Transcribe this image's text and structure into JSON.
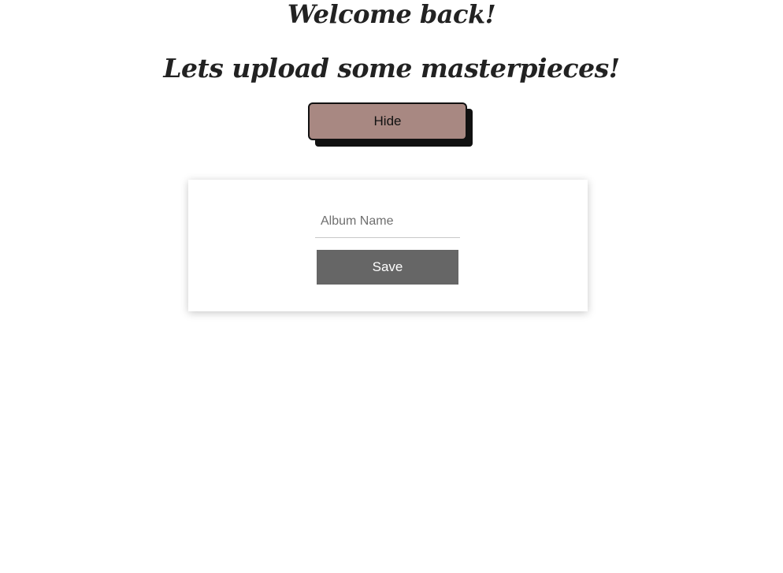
{
  "header": {
    "welcome": "Welcome back!",
    "subtitle": "Lets upload some masterpieces!"
  },
  "toggle": {
    "hide_label": "Hide"
  },
  "album_form": {
    "name_placeholder": "Album Name",
    "name_value": "",
    "save_label": "Save"
  },
  "colors": {
    "hide_button_bg": "#a88882",
    "save_button_bg": "#666666",
    "heading_text": "#222222"
  }
}
